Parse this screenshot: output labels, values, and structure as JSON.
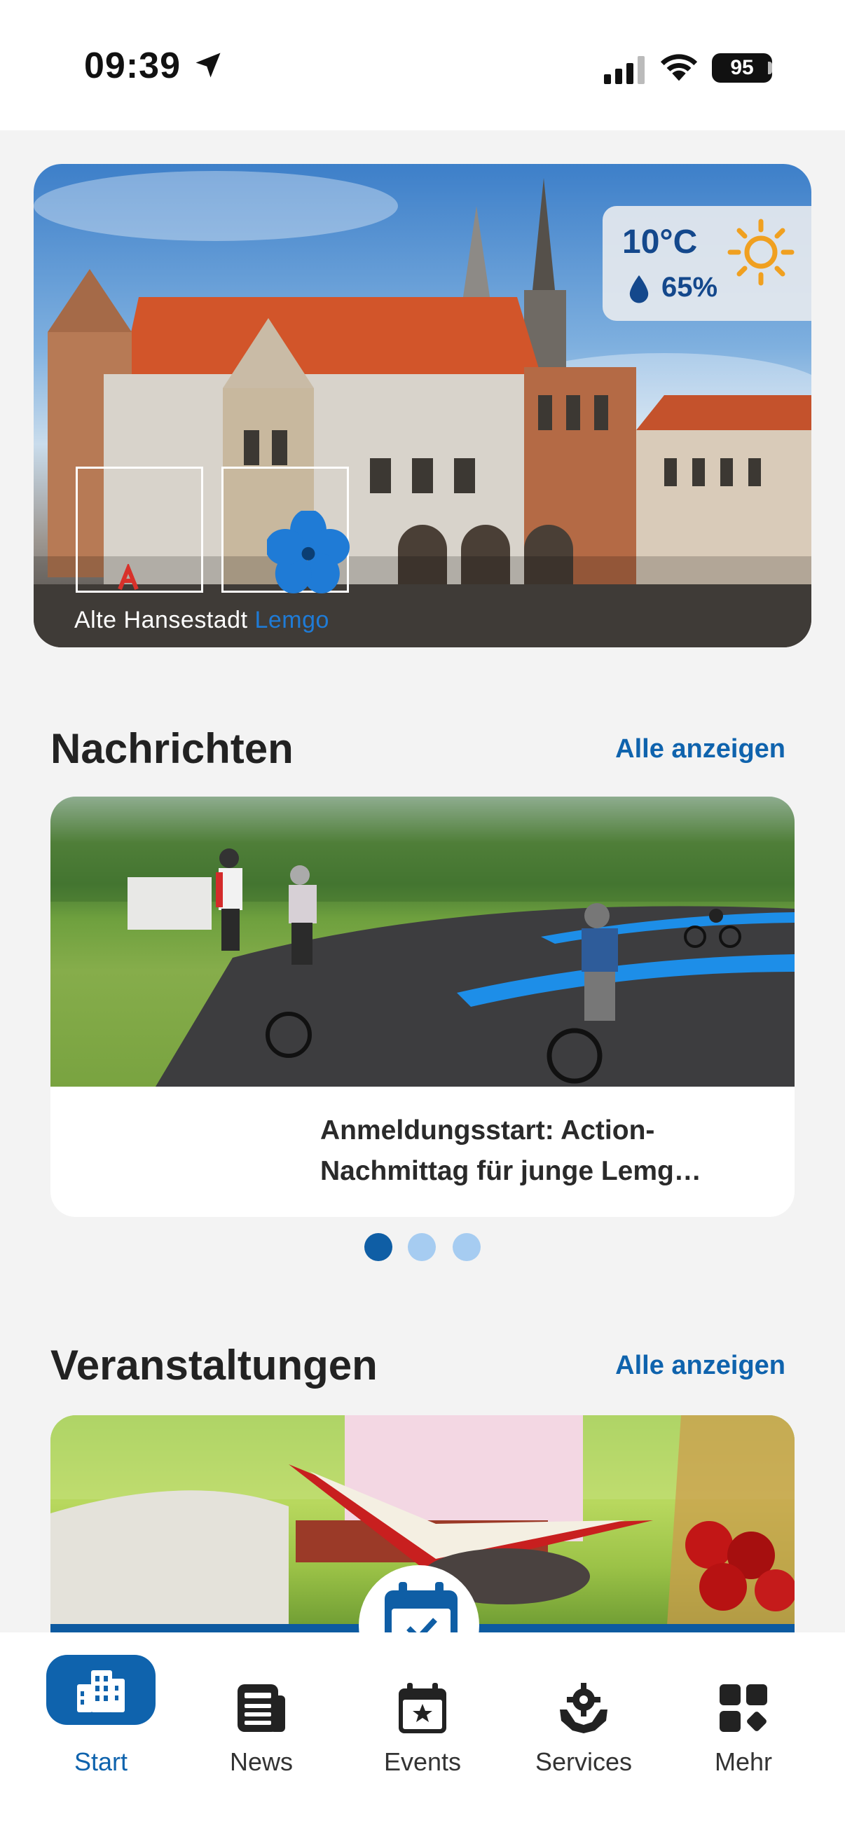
{
  "status_bar": {
    "time": "09:39",
    "battery": "95",
    "icons": [
      "location-arrow-icon",
      "cellular-signal-icon",
      "wifi-icon",
      "battery-icon"
    ]
  },
  "hero": {
    "weather": {
      "temperature": "10°C",
      "humidity": "65%",
      "icons": [
        "sun-icon",
        "drop-icon"
      ],
      "temp_color": "#14488c",
      "sun_color": "#f0a020"
    },
    "caption_prefix": "Alte Hansestadt",
    "caption_accent": "Lemgo",
    "accent_color": "#1f7bd6"
  },
  "news": {
    "title": "Nachrichten",
    "show_all": "Alle anzeigen",
    "items": [
      {
        "title": "Anmeldungsstart: Action-Nachmittag für junge Lemg…"
      }
    ],
    "carousel": {
      "count": 3,
      "active_index": 0
    }
  },
  "events": {
    "title": "Veranstaltungen",
    "show_all": "Alle anzeigen",
    "badge_icon": "calendar-check-icon"
  },
  "tabbar": {
    "active_color": "#0f63ad",
    "tabs": [
      {
        "label": "Start",
        "icon": "city-buildings-icon",
        "active": true
      },
      {
        "label": "News",
        "icon": "newspaper-icon",
        "active": false
      },
      {
        "label": "Events",
        "icon": "calendar-star-icon",
        "active": false
      },
      {
        "label": "Services",
        "icon": "gear-hands-icon",
        "active": false
      },
      {
        "label": "Mehr",
        "icon": "grid-more-icon",
        "active": false
      }
    ]
  }
}
